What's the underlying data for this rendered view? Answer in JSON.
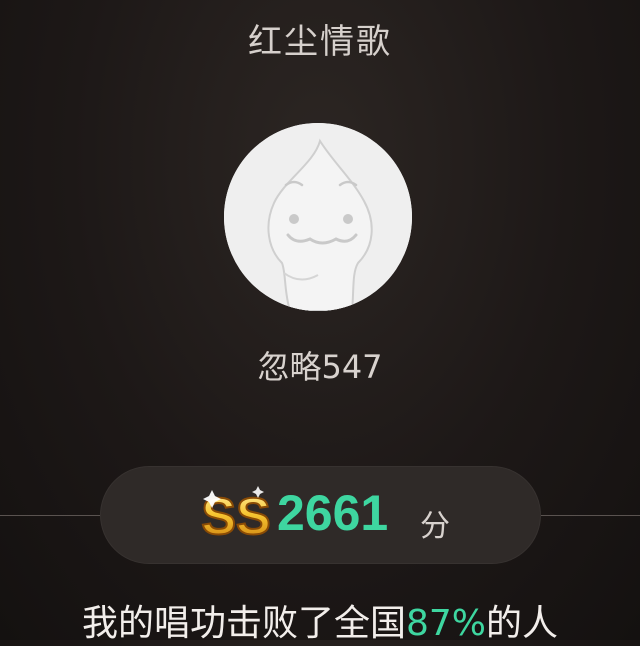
{
  "song": {
    "title": "红尘情歌"
  },
  "user": {
    "nickname": "忽略547"
  },
  "score": {
    "grade": "SS",
    "value": "2661",
    "unit": "分"
  },
  "result": {
    "prefix": "我的唱功击败了全国",
    "percent": "87%",
    "suffix": "的人"
  },
  "colors": {
    "accent": "#3ed6a0",
    "background": "#1d1817",
    "pill": "#2f2a28",
    "badge_gold": "#f2b21c"
  },
  "icons": {
    "avatar": "default-avatar-icon",
    "grade": "ss-grade-badge-icon"
  }
}
